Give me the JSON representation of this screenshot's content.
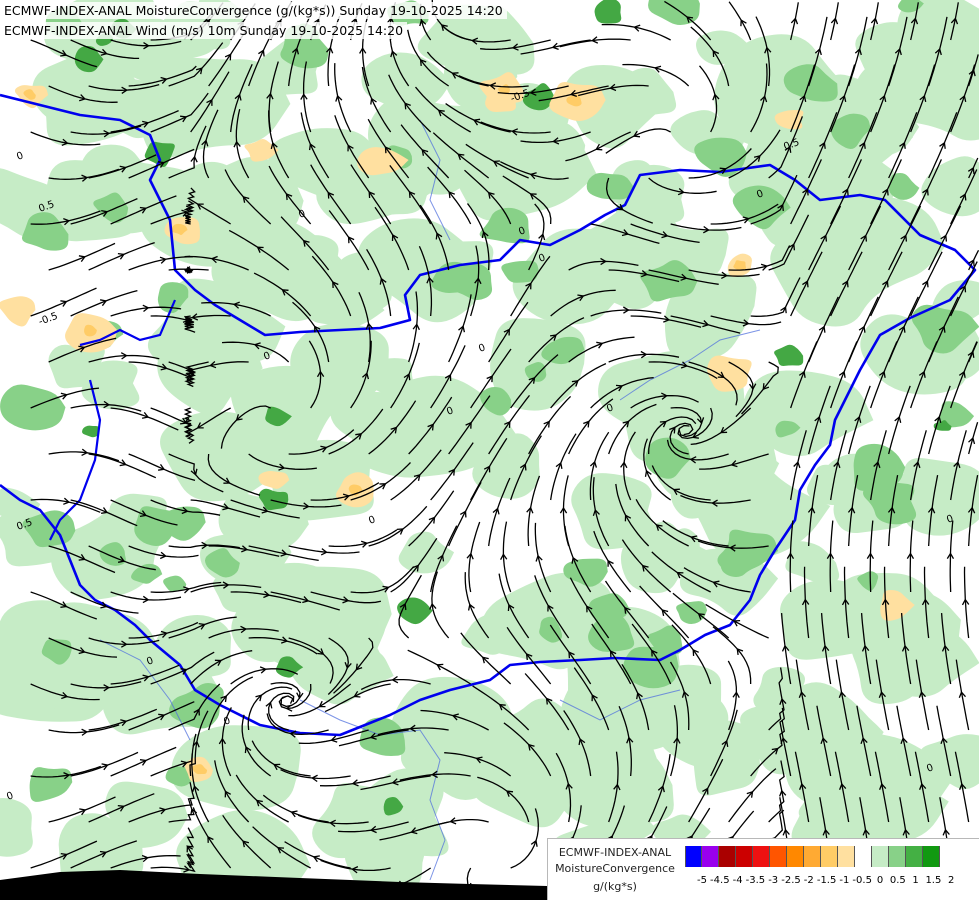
{
  "titles": {
    "line1": "ECMWF-INDEX-ANAL MoistureConvergence (g/(kg*s)) Sunday 19-10-2025 14:20",
    "line2": "ECMWF-INDEX-ANAL Wind (m/s) 10m Sunday 19-10-2025 14:20"
  },
  "legend": {
    "title_model": "ECMWF-INDEX-ANAL",
    "title_field": "MoistureConvergence",
    "unit": "g/(kg*s)",
    "tick_labels": [
      "-5",
      "-4.5",
      "-4",
      "-3.5",
      "-3",
      "-2.5",
      "-2",
      "-1.5",
      "-1",
      "-0.5",
      "0",
      "0.5",
      "1",
      "1.5",
      "2"
    ],
    "swatch_colors": [
      "#0000ff",
      "#9900ee",
      "#aa0000",
      "#cc0000",
      "#ee1111",
      "#ff5500",
      "#ff8800",
      "#ffaa33",
      "#ffcc66",
      "#ffe0a0",
      "#ffffff",
      "#c6ecc6",
      "#88d188",
      "#44b044",
      "#119911"
    ]
  },
  "contour_labels": [
    "0",
    "0",
    "0",
    "0",
    "0.5",
    "-0.5",
    "0",
    "0.5",
    "0",
    "0",
    "-0.5",
    "0",
    "0",
    "0.5",
    "0",
    "0",
    "0",
    "0",
    "0",
    "0"
  ],
  "colors": {
    "background": "#ffffff",
    "convergence_light": "#c6ecc6",
    "convergence_mid": "#88d188",
    "convergence_strong": "#44a844",
    "divergence_light": "#ffe0a0",
    "divergence_mid": "#ffcc66",
    "border": "#0000ee",
    "river": "#5070dd",
    "streamline": "#000000",
    "ground": "#000000"
  }
}
